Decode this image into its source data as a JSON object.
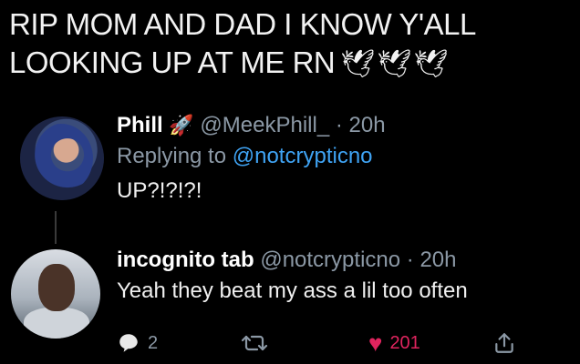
{
  "caption": {
    "line1": "RIP MOM AND DAD I KNOW Y'ALL",
    "line2": "LOOKING UP AT ME RN",
    "emojis": "🕊🕊🕊"
  },
  "tweet1": {
    "name": "Phill",
    "name_emoji": "🚀",
    "handle": "@MeekPhill_",
    "separator": "·",
    "time": "20h",
    "replying_prefix": "Replying to",
    "replying_handle": "@notcrypticno",
    "text": "UP?!?!?!"
  },
  "tweet2": {
    "name": "incognito tab",
    "handle": "@notcrypticno",
    "separator": "·",
    "time": "20h",
    "text": "Yeah they beat my ass a lil too often",
    "reply_count": "2",
    "like_count": "201"
  },
  "colors": {
    "background": "#000000",
    "secondary_text": "#8b98a5",
    "link": "#3fa3f3",
    "like": "#e0245e"
  },
  "icons": {
    "reply": "reply-icon",
    "retweet": "retweet-icon",
    "like": "heart-icon",
    "share": "share-icon"
  }
}
